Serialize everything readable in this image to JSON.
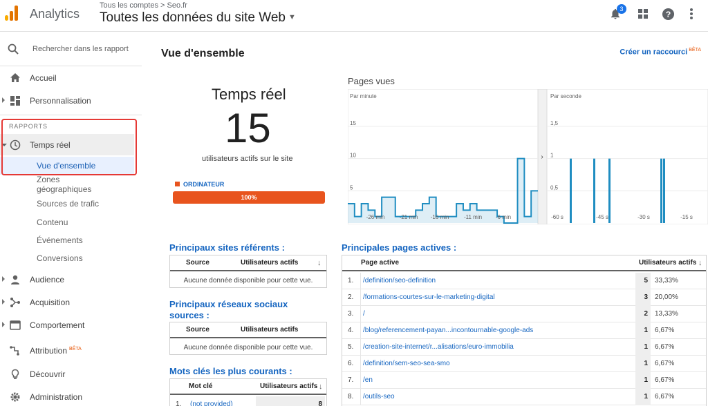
{
  "header": {
    "app_name": "Analytics",
    "breadcrumb": "Tous les comptes > Seo.fr",
    "view_title": "Toutes les données du site Web",
    "notifications_count": "3",
    "icons": [
      "bell-icon",
      "apps-grid-icon",
      "help-icon",
      "more-vert-icon"
    ]
  },
  "sidebar": {
    "search_placeholder": "Rechercher dans les rapport",
    "home": "Accueil",
    "customization": "Personnalisation",
    "section_label": "RAPPORTS",
    "realtime": "Temps réel",
    "realtime_sub": [
      "Vue d'ensemble",
      "Zones géographiques",
      "Sources de trafic",
      "Contenu",
      "Événements",
      "Conversions"
    ],
    "audience": "Audience",
    "acquisition": "Acquisition",
    "behavior": "Comportement",
    "attribution": "Attribution",
    "attribution_badge": "BÊTA",
    "discover": "Découvrir",
    "admin": "Administration"
  },
  "main": {
    "page_title": "Vue d'ensemble",
    "shortcut": "Créer un raccourci",
    "shortcut_badge": "BÊTA",
    "realtime_title": "Temps réel",
    "active_users": "15",
    "active_users_label": "utilisateurs actifs sur le site",
    "device_label": "ORDINATEUR",
    "device_percent": "100%",
    "device_fraction": 1.0
  },
  "chart_data": [
    {
      "type": "bar",
      "title": "Pages vues",
      "subtitle": "Par minute",
      "y_ticks": [
        "5",
        "10",
        "15"
      ],
      "ylim": [
        0,
        15
      ],
      "x_tick_labels": [
        "-26 min",
        "-21 min",
        "-16 min",
        "-11 min",
        "-6 min"
      ],
      "values": [
        3,
        1,
        3,
        2,
        1,
        4,
        4,
        1,
        1,
        1,
        2,
        3,
        4,
        1,
        1,
        1,
        3,
        2,
        3,
        2,
        2,
        2,
        1,
        0,
        0,
        10,
        1,
        5
      ]
    },
    {
      "type": "bar",
      "subtitle": "Par seconde",
      "y_ticks": [
        "0,5",
        "1",
        "1,5"
      ],
      "ylim": [
        0,
        1.5
      ],
      "x_tick_labels": [
        "-60 s",
        "-45 s",
        "-30 s",
        "-15 s"
      ],
      "values": [
        1,
        1,
        1,
        1,
        1
      ]
    }
  ],
  "referrers": {
    "title": "Principaux sites référents :",
    "col_source": "Source",
    "col_users": "Utilisateurs actifs",
    "empty": "Aucune donnée disponible pour cette vue."
  },
  "social": {
    "title": "Principaux réseaux sociaux sources :",
    "col_source": "Source",
    "col_users": "Utilisateurs actifs",
    "empty": "Aucune donnée disponible pour cette vue."
  },
  "keywords": {
    "title": "Mots clés les plus courants :",
    "col_keyword": "Mot clé",
    "col_users": "Utilisateurs actifs",
    "rows": [
      {
        "num": "1.",
        "keyword": "(not provided)",
        "value": "8"
      }
    ]
  },
  "top_pages": {
    "title": "Principales pages actives :",
    "col_page": "Page active",
    "col_users": "Utilisateurs actifs",
    "rows": [
      {
        "num": "1.",
        "path": "/definition/seo-definition",
        "value": "5",
        "pct": "33,33%"
      },
      {
        "num": "2.",
        "path": "/formations-courtes-sur-le-marketing-digital",
        "value": "3",
        "pct": "20,00%"
      },
      {
        "num": "3.",
        "path": "/",
        "value": "2",
        "pct": "13,33%"
      },
      {
        "num": "4.",
        "path": "/blog/referencement-payan...incontournable-google-ads",
        "value": "1",
        "pct": "6,67%"
      },
      {
        "num": "5.",
        "path": "/creation-site-internet/r...alisations/euro-immobilia",
        "value": "1",
        "pct": "6,67%"
      },
      {
        "num": "6.",
        "path": "/definition/sem-seo-sea-smo",
        "value": "1",
        "pct": "6,67%"
      },
      {
        "num": "7.",
        "path": "/en",
        "value": "1",
        "pct": "6,67%"
      },
      {
        "num": "8.",
        "path": "/outils-seo",
        "value": "1",
        "pct": "6,67%"
      }
    ]
  }
}
